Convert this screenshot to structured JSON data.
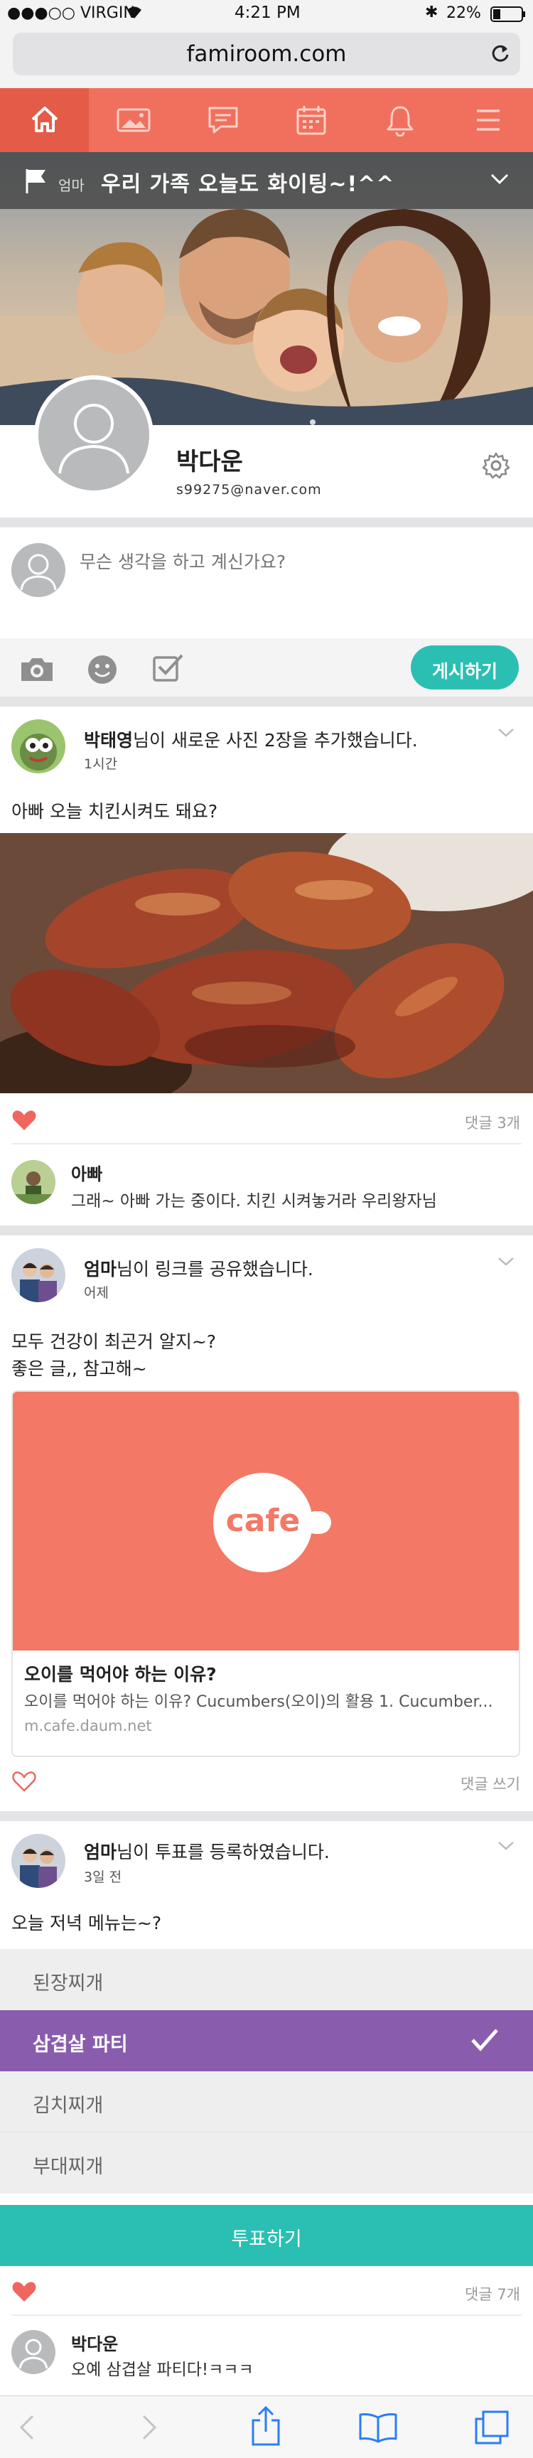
{
  "status_bar": {
    "carrier": "●●●○○ VIRGIN",
    "time": "4:21 PM",
    "battery": "22%"
  },
  "browser": {
    "url": "famiroom.com"
  },
  "nav_icons": [
    "home-icon",
    "photo-icon",
    "chat-icon",
    "calendar-icon",
    "bell-icon",
    "menu-icon"
  ],
  "colors": {
    "coral": "#f0705d",
    "teal": "#2bbfb3",
    "purple": "#8a5cad",
    "heart": "#ef6660"
  },
  "banner": {
    "tag": "엄마",
    "message": "우리 가족 오늘도 화이팅~!^^"
  },
  "profile": {
    "name": "박다운",
    "email": "s99275@naver.com"
  },
  "composer": {
    "placeholder": "무슨 생각을 하고 계신가요?",
    "post_button": "게시하기"
  },
  "post1": {
    "author": "박태영",
    "action": "님이 새로운 사진 2장을 추가했습니다.",
    "time": "1시간",
    "text": "아빠 오늘 치킨시켜도 돼요?",
    "comment_count": "댓글 3개",
    "comment": {
      "author": "아빠",
      "text": "그래~ 아빠 가는 중이다. 치킨 시켜놓거라 우리왕자님"
    }
  },
  "post2": {
    "author": "엄마",
    "action": "님이 링크를 공유했습니다.",
    "time": "어제",
    "text_line1": "모두 건강이 최곤거 알지~?",
    "text_line2": "좋은 글,, 참고해~",
    "link": {
      "logo": "cafe",
      "title": "오이를 먹어야 하는 이유?",
      "desc": "오이를 먹어야 하는 이유? Cucumbers(오이)의 활용 1. Cucumber...",
      "domain": "m.cafe.daum.net"
    },
    "comment_action": "댓글 쓰기"
  },
  "post3": {
    "author": "엄마",
    "action": "님이 투표를 등록하였습니다.",
    "time": "3일 전",
    "question": "오늘 저녁 메뉴는~?",
    "options": [
      "된장찌개",
      "삼겹살 파티",
      "김치찌개",
      "부대찌개"
    ],
    "selected_index": 1,
    "vote_button": "투표하기",
    "comment_count": "댓글 7개",
    "comment": {
      "author": "박다운",
      "text": "오예 삼겹살 파티다!ㅋㅋㅋ"
    }
  },
  "toolbar_icons": [
    "back-icon",
    "forward-icon",
    "share-icon",
    "bookmarks-icon",
    "tabs-icon"
  ]
}
